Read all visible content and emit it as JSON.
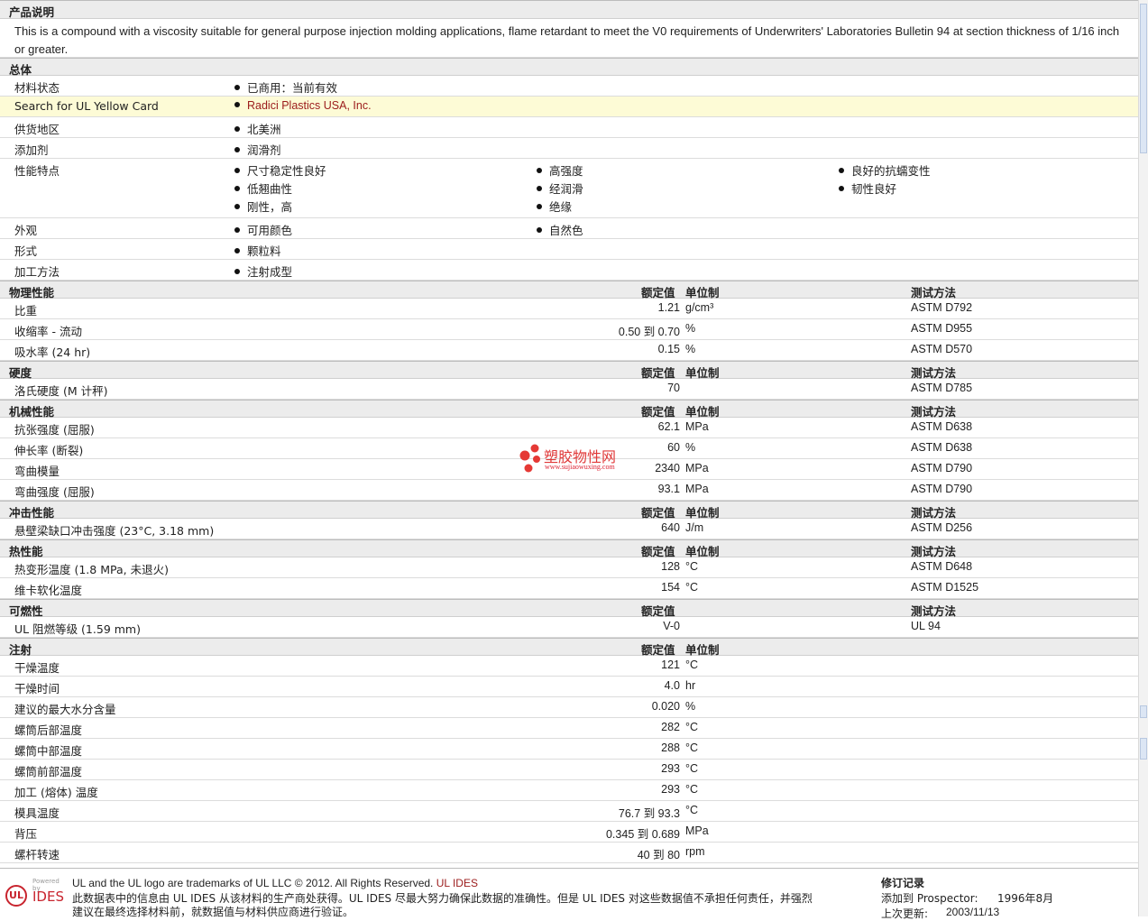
{
  "description": {
    "title": "产品说明",
    "text": "This is a compound with a viscosity suitable for general purpose injection molding applications, flame retardant to meet the V0 requirements of Underwriters' Laboratories Bulletin 94 at section thickness of 1/16 inch or greater."
  },
  "general": {
    "title": "总体",
    "rows": [
      {
        "label": "材料状态",
        "items": [
          [
            "已商用：当前有效"
          ]
        ]
      },
      {
        "label": "Search for UL Yellow Card",
        "items": [
          [
            "Radici Plastics USA, Inc."
          ]
        ],
        "link": true
      },
      {
        "label": "供货地区",
        "items": [
          [
            "北美洲"
          ]
        ]
      },
      {
        "label": "添加剂",
        "items": [
          [
            "润滑剂"
          ]
        ]
      },
      {
        "label": "性能特点",
        "items": [
          [
            "尺寸稳定性良好",
            "低翘曲性",
            "刚性，高"
          ],
          [
            "高强度",
            "经润滑",
            "绝缘"
          ],
          [
            "良好的抗蠕变性",
            "韧性良好"
          ]
        ]
      },
      {
        "label": "外观",
        "items": [
          [
            "可用颜色"
          ],
          [
            "自然色"
          ]
        ]
      },
      {
        "label": "形式",
        "items": [
          [
            "颗粒料"
          ]
        ]
      },
      {
        "label": "加工方法",
        "items": [
          [
            "注射成型"
          ]
        ]
      }
    ]
  },
  "headers": {
    "value": "额定值",
    "unit": "单位制",
    "method": "测试方法"
  },
  "sections": [
    {
      "title": "物理性能",
      "show_unit": true,
      "show_method": true,
      "rows": [
        {
          "label": "比重",
          "value": "1.21",
          "unit": "g/cm³",
          "method": "ASTM D792"
        },
        {
          "label": "收缩率 - 流动",
          "value": "0.50 到  0.70",
          "unit": "%",
          "method": "ASTM D955"
        },
        {
          "label": "吸水率 (24 hr)",
          "value": "0.15",
          "unit": "%",
          "method": "ASTM D570"
        }
      ]
    },
    {
      "title": "硬度",
      "show_unit": true,
      "show_method": true,
      "rows": [
        {
          "label": "洛氏硬度 (M 计秤)",
          "value": "70",
          "unit": "",
          "method": "ASTM D785"
        }
      ]
    },
    {
      "title": "机械性能",
      "show_unit": true,
      "show_method": true,
      "rows": [
        {
          "label": "抗张强度 (屈服)",
          "value": "62.1",
          "unit": "MPa",
          "method": "ASTM D638"
        },
        {
          "label": "伸长率 (断裂)",
          "value": "60",
          "unit": "%",
          "method": "ASTM D638"
        },
        {
          "label": "弯曲模量",
          "value": "2340",
          "unit": "MPa",
          "method": "ASTM D790"
        },
        {
          "label": "弯曲强度 (屈服)",
          "value": "93.1",
          "unit": "MPa",
          "method": "ASTM D790"
        }
      ]
    },
    {
      "title": "冲击性能",
      "show_unit": true,
      "show_method": true,
      "rows": [
        {
          "label": "悬壁梁缺口冲击强度 (23°C, 3.18 mm)",
          "value": "640",
          "unit": "J/m",
          "method": "ASTM D256"
        }
      ]
    },
    {
      "title": "热性能",
      "show_unit": true,
      "show_method": true,
      "rows": [
        {
          "label": "热变形温度 (1.8 MPa, 未退火)",
          "value": "128",
          "unit": "°C",
          "method": "ASTM D648"
        },
        {
          "label": "维卡软化温度",
          "value": "154",
          "unit": "°C",
          "method": "ASTM D1525"
        }
      ]
    },
    {
      "title": "可燃性",
      "show_unit": false,
      "show_method": true,
      "rows": [
        {
          "label": "UL 阻燃等级 (1.59 mm)",
          "value": "V-0",
          "unit": "",
          "method": "UL 94"
        }
      ]
    },
    {
      "title": "注射",
      "show_unit": true,
      "show_method": false,
      "rows": [
        {
          "label": "干燥温度",
          "value": "121",
          "unit": "°C",
          "method": ""
        },
        {
          "label": "干燥时间",
          "value": "4.0",
          "unit": "hr",
          "method": ""
        },
        {
          "label": "建议的最大水分含量",
          "value": "0.020",
          "unit": "%",
          "method": ""
        },
        {
          "label": "螺筒后部温度",
          "value": "282",
          "unit": "°C",
          "method": ""
        },
        {
          "label": "螺筒中部温度",
          "value": "288",
          "unit": "°C",
          "method": ""
        },
        {
          "label": "螺筒前部温度",
          "value": "293",
          "unit": "°C",
          "method": ""
        },
        {
          "label": "加工 (熔体) 温度",
          "value": "293",
          "unit": "°C",
          "method": ""
        },
        {
          "label": "模具温度",
          "value": "76.7 到  93.3",
          "unit": "°C",
          "method": ""
        },
        {
          "label": "背压",
          "value": "0.345 到  0.689",
          "unit": "MPa",
          "method": ""
        },
        {
          "label": "螺杆转速",
          "value": "40 到  80",
          "unit": "rpm",
          "method": ""
        }
      ]
    }
  ],
  "watermark": {
    "title": "塑胶物性网",
    "url": "www.sujiaowuxing.com"
  },
  "footer": {
    "logo_ul": "UL",
    "logo_powered": "Powered by",
    "logo_ides": "IDES",
    "trademark": "UL and the UL logo are trademarks of UL LLC © 2012. All Rights Reserved.",
    "trademark_link": "UL IDES",
    "disclaimer_1": "此数据表中的信息由  UL IDES 从该材料的生产商处获得。UL IDES 尽最大努力确保此数据的准确性。但是  UL IDES 对这些数据值不承担任何责任，并强烈",
    "disclaimer_2": "建议在最终选择材料前，就数据值与材料供应商进行验证。",
    "revision_title": "修订记录",
    "added_label": "添加到  Prospector:",
    "added_date": "1996年8月",
    "last_updated_label": "上次更新:",
    "last_updated_date": "2003/11/13"
  },
  "colors": {
    "link": "#9b1b1b",
    "highlight_row": "#fdfbd6",
    "section_bg": "#ececec",
    "logo_red": "#c8242e"
  }
}
